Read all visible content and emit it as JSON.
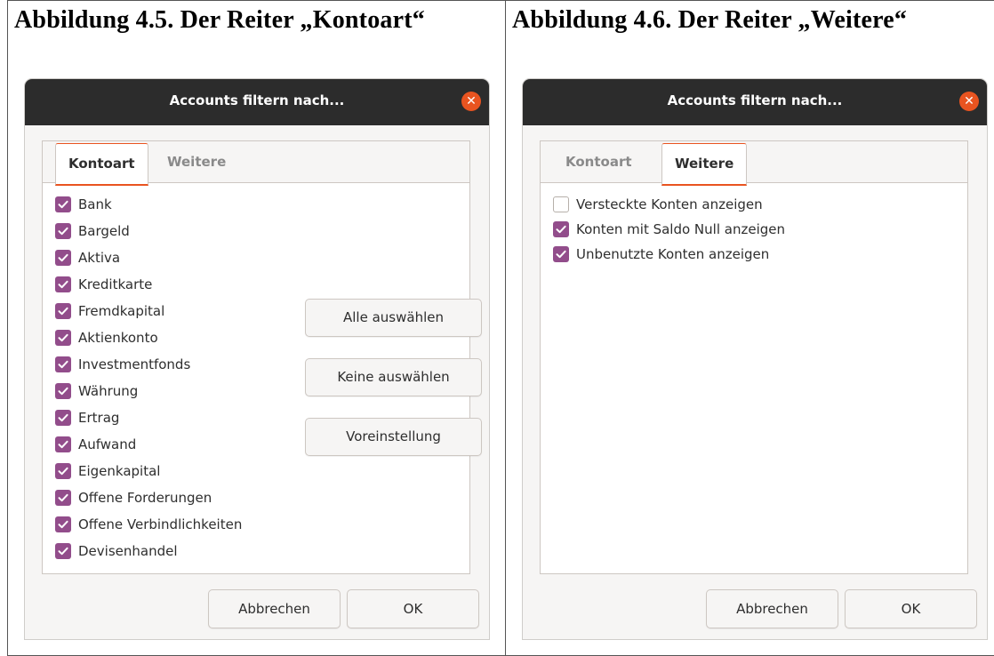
{
  "left": {
    "caption": "Abbildung 4.5. Der Reiter „Kontoart“",
    "dialog_title": "Accounts filtern nach...",
    "tabs": [
      {
        "label": "Kontoart",
        "active": true
      },
      {
        "label": "Weitere",
        "active": false
      }
    ],
    "account_types": [
      {
        "label": "Bank",
        "checked": true
      },
      {
        "label": "Bargeld",
        "checked": true
      },
      {
        "label": "Aktiva",
        "checked": true
      },
      {
        "label": "Kreditkarte",
        "checked": true
      },
      {
        "label": "Fremdkapital",
        "checked": true
      },
      {
        "label": "Aktienkonto",
        "checked": true
      },
      {
        "label": "Investmentfonds",
        "checked": true
      },
      {
        "label": "Währung",
        "checked": true
      },
      {
        "label": "Ertrag",
        "checked": true
      },
      {
        "label": "Aufwand",
        "checked": true
      },
      {
        "label": "Eigenkapital",
        "checked": true
      },
      {
        "label": "Offene Forderungen",
        "checked": true
      },
      {
        "label": "Offene Verbindlichkeiten",
        "checked": true
      },
      {
        "label": "Devisenhandel",
        "checked": true
      }
    ],
    "select_all_label": "Alle auswählen",
    "select_none_label": "Keine auswählen",
    "default_label": "Voreinstellung",
    "cancel_label": "Abbrechen",
    "ok_label": "OK"
  },
  "right": {
    "caption": "Abbildung 4.6. Der Reiter „Weitere“",
    "dialog_title": "Accounts filtern nach...",
    "tabs": [
      {
        "label": "Kontoart",
        "active": false
      },
      {
        "label": "Weitere",
        "active": true
      }
    ],
    "options": [
      {
        "label": "Versteckte Konten anzeigen",
        "checked": false
      },
      {
        "label": "Konten mit Saldo Null anzeigen",
        "checked": true
      },
      {
        "label": "Unbenutzte Konten anzeigen",
        "checked": true
      }
    ],
    "cancel_label": "Abbrechen",
    "ok_label": "OK"
  },
  "colors": {
    "titlebar": "#2c2c2c",
    "accent": "#e95420",
    "checkbox_checked": "#924d8b",
    "dialog_bg": "#f6f5f4"
  },
  "icons": {
    "close": "close-icon",
    "check": "checkmark-icon"
  }
}
